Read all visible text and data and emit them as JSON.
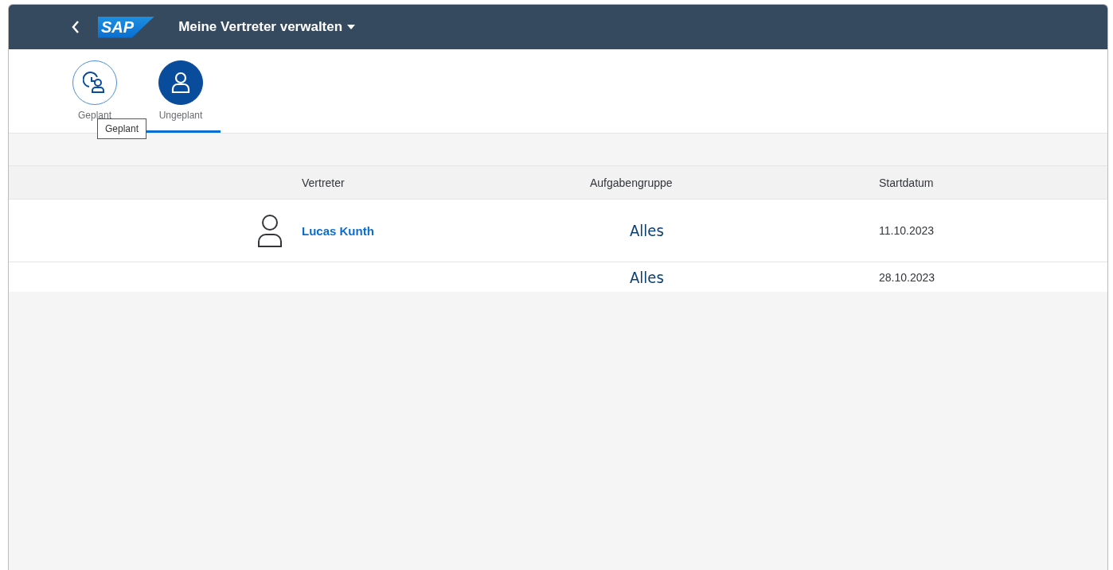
{
  "header": {
    "title": "Meine Vertreter verwalten",
    "logo": "SAP"
  },
  "tabs": [
    {
      "label": "Geplant",
      "kind": "scheduled",
      "selected": false
    },
    {
      "label": "Ungeplant",
      "kind": "unscheduled",
      "selected": true
    }
  ],
  "tooltip": "Geplant",
  "table": {
    "columns": [
      "Vertreter",
      "Aufgabengruppe",
      "Startdatum"
    ],
    "rows": [
      {
        "vertreter": "Lucas Kunth",
        "aufgabengruppe": "Alles",
        "startdatum": "11.10.2023"
      },
      {
        "vertreter": "",
        "aufgabengruppe": "Alles",
        "startdatum": "28.10.2023"
      }
    ]
  }
}
